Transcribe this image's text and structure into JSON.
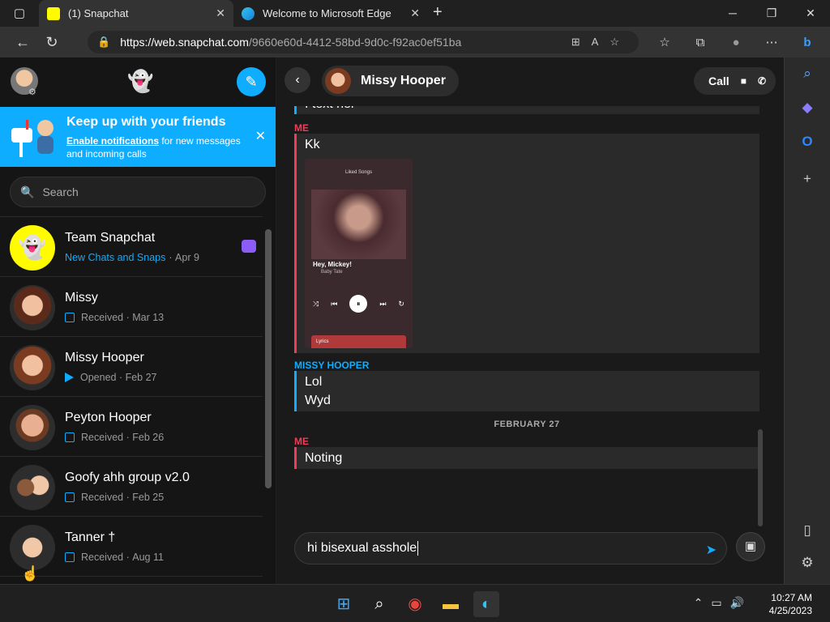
{
  "browser": {
    "tabs": [
      {
        "title": "(1) Snapchat",
        "active": true
      },
      {
        "title": "Welcome to Microsoft Edge",
        "active": false
      }
    ],
    "url_host": "https://web.snapchat.com",
    "url_path": "/9660e60d-4412-58bd-9d0c-f92ac0ef51ba"
  },
  "banner": {
    "title": "Keep up with your friends",
    "link": "Enable notifications",
    "text": " for new messages and incoming calls"
  },
  "search": {
    "placeholder": "Search"
  },
  "chats": [
    {
      "name": "Team Snapchat",
      "status": "New Chats and Snaps",
      "date": "Apr 9",
      "status_type": "new"
    },
    {
      "name": "Missy",
      "status": "Received",
      "date": "Mar 13",
      "status_type": "received"
    },
    {
      "name": "Missy Hooper",
      "status": "Opened",
      "date": "Feb 27",
      "status_type": "opened"
    },
    {
      "name": "Peyton Hooper",
      "status": "Received",
      "date": "Feb 26",
      "status_type": "received"
    },
    {
      "name": "Goofy ahh group v2.0",
      "status": "Received",
      "date": "Feb 25",
      "status_type": "received"
    },
    {
      "name": "Tanner †",
      "status": "Received",
      "date": "Aug 11",
      "status_type": "received"
    }
  ],
  "conversation": {
    "contact": "Missy Hooper",
    "call_label": "Call",
    "partial_top": "I text her",
    "messages": [
      {
        "sender": "ME",
        "lines": [
          "Kk"
        ]
      },
      {
        "sender": "MISSY HOOPER",
        "lines": [
          "Lol",
          "Wyd"
        ]
      },
      {
        "sender": "ME",
        "lines": [
          "Noting"
        ]
      }
    ],
    "date_separator": "FEBRUARY 27",
    "screenshot": {
      "song": "Hey, Mickey!",
      "artist": "Baby Tate",
      "header": "Liked Songs",
      "lyrics": "Lyrics"
    }
  },
  "composer": {
    "value": "hi bisexual asshole"
  },
  "taskbar": {
    "time": "10:27 AM",
    "date": "4/25/2023"
  }
}
